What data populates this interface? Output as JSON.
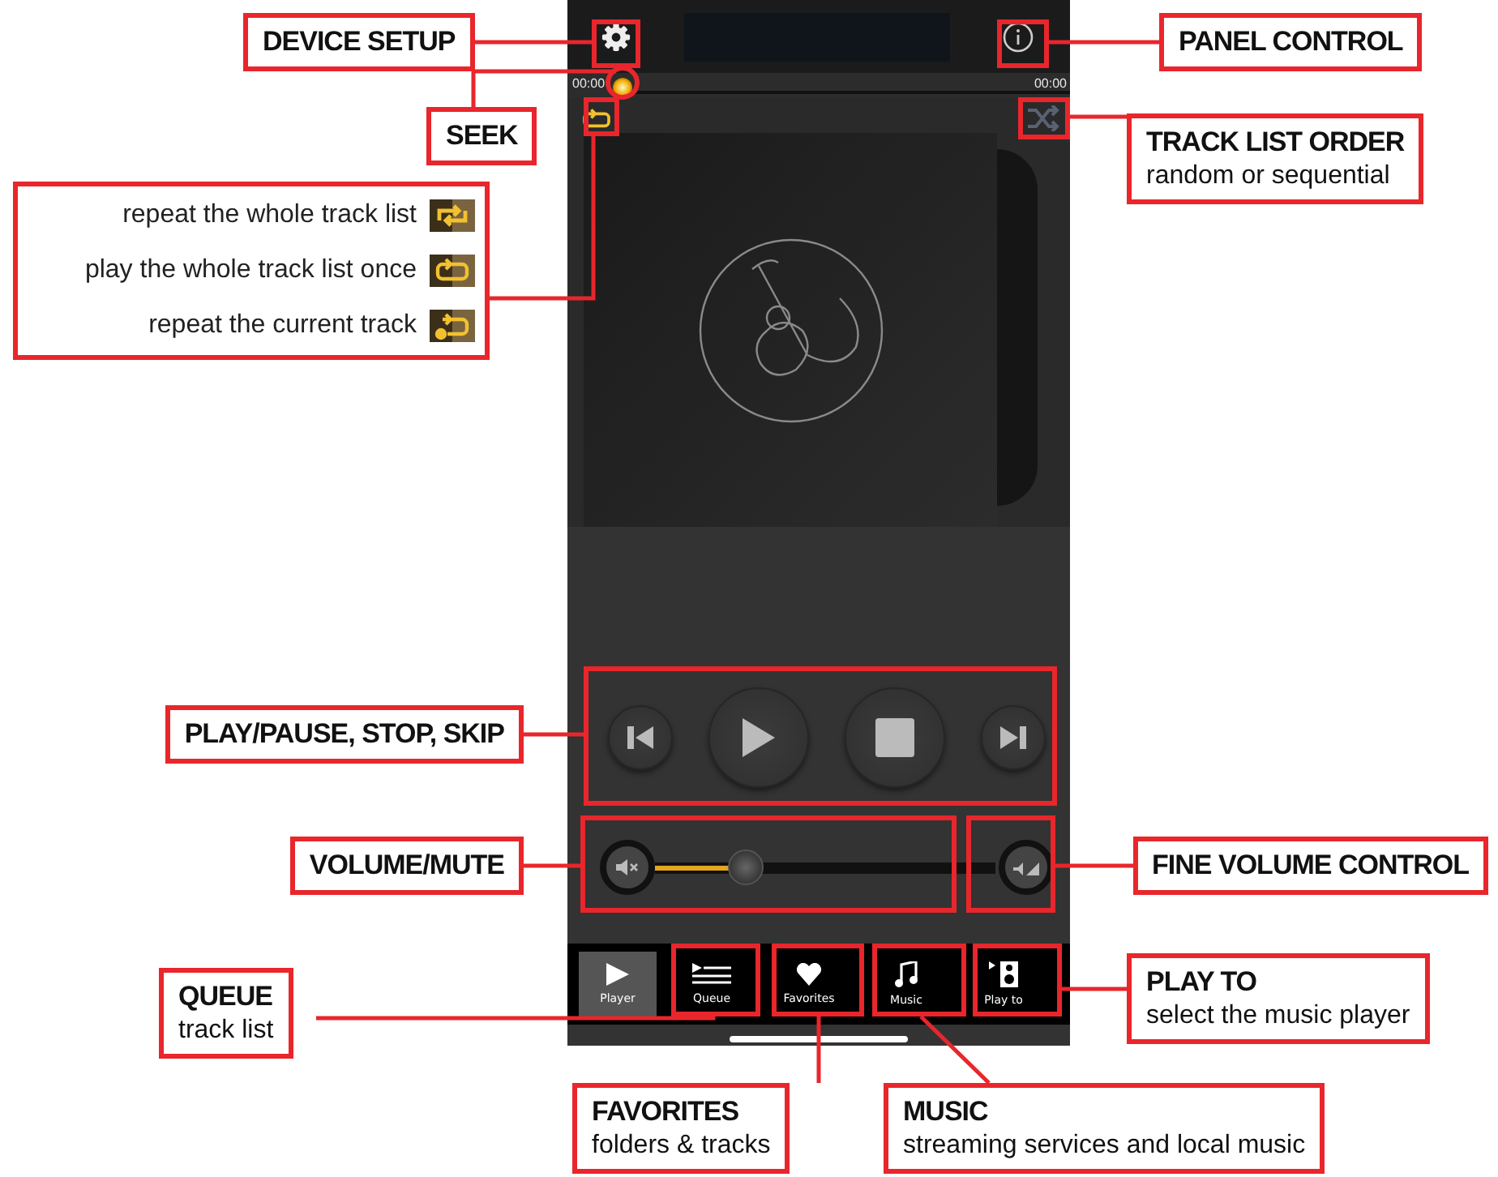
{
  "seek": {
    "elapsed": "00:00",
    "total": "00:00",
    "level": 0
  },
  "repeat_button": {
    "kind": "once"
  },
  "volume": {
    "level": 0.3
  },
  "tabs": [
    {
      "label": "Player",
      "kind": "player",
      "selected": true
    },
    {
      "label": "Queue",
      "kind": "queue",
      "selected": false
    },
    {
      "label": "Favorites",
      "kind": "favorites",
      "selected": false
    },
    {
      "label": "Music",
      "kind": "music",
      "selected": false
    },
    {
      "label": "Play to",
      "kind": "playto",
      "selected": false
    }
  ],
  "callouts": [
    {
      "title": "DEVICE SETUP"
    },
    {
      "title": "PANEL CONTROL"
    },
    {
      "title": "SEEK"
    },
    {
      "title": "TRACK LIST ORDER",
      "note": "random or sequential"
    },
    {
      "title": "PLAY/PAUSE, STOP, SKIP"
    },
    {
      "title": "VOLUME/MUTE"
    },
    {
      "title": "FINE VOLUME CONTROL"
    },
    {
      "title": "QUEUE",
      "note": "track list"
    },
    {
      "title": "PLAY TO",
      "note": "select the music player"
    },
    {
      "title": "FAVORITES",
      "note": "folders & tracks"
    },
    {
      "title": "MUSIC",
      "note": "streaming services and local music"
    }
  ],
  "repeat_legend": [
    {
      "text": "repeat the whole track list",
      "kind": "all"
    },
    {
      "text": "play the whole track list once",
      "kind": "once"
    },
    {
      "text": "repeat the current track",
      "kind": "one"
    }
  ]
}
